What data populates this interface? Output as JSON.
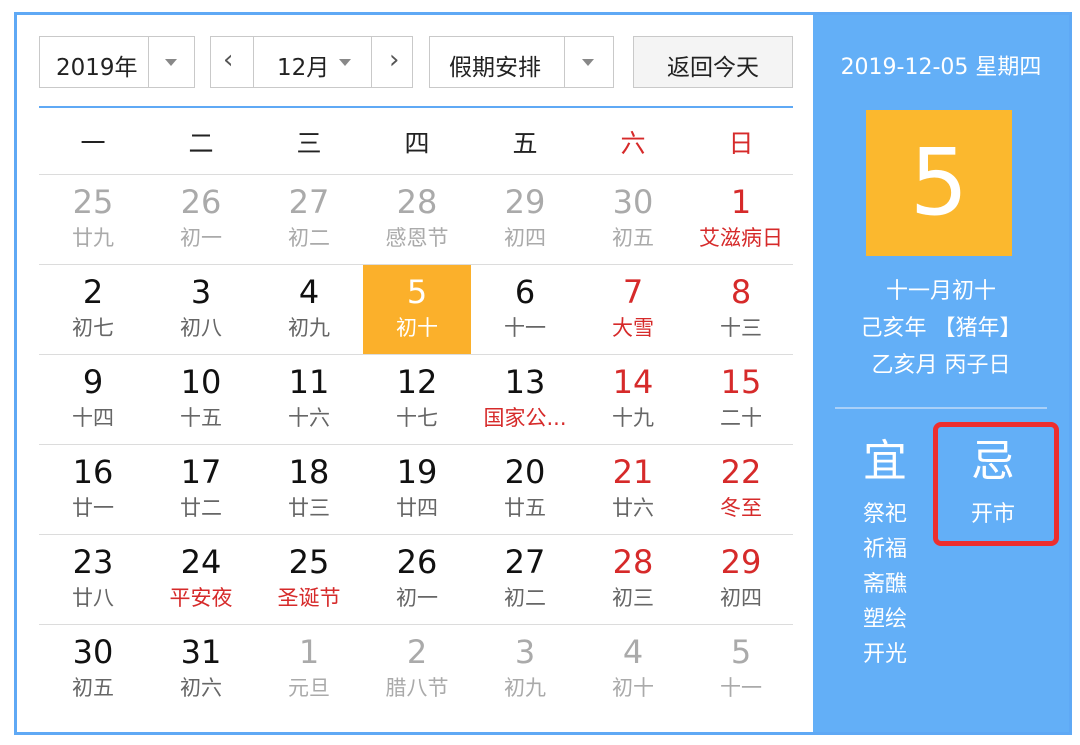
{
  "toolbar": {
    "year": "2019年",
    "month": "12月",
    "prev_icon": "‹",
    "next_icon": "›",
    "holiday": "假期安排",
    "today": "返回今天"
  },
  "weekdays": [
    "一",
    "二",
    "三",
    "四",
    "五",
    "六",
    "日"
  ],
  "weeks": [
    [
      {
        "day": "25",
        "lunar": "廿九",
        "other": true
      },
      {
        "day": "26",
        "lunar": "初一",
        "other": true
      },
      {
        "day": "27",
        "lunar": "初二",
        "other": true
      },
      {
        "day": "28",
        "lunar": "感恩节",
        "other": true
      },
      {
        "day": "29",
        "lunar": "初四",
        "other": true
      },
      {
        "day": "30",
        "lunar": "初五",
        "other": true
      },
      {
        "day": "1",
        "lunar": "艾滋病日",
        "red": true
      }
    ],
    [
      {
        "day": "2",
        "lunar": "初七"
      },
      {
        "day": "3",
        "lunar": "初八"
      },
      {
        "day": "4",
        "lunar": "初九"
      },
      {
        "day": "5",
        "lunar": "初十",
        "selected": true
      },
      {
        "day": "6",
        "lunar": "十一"
      },
      {
        "day": "7",
        "lunar": "大雪",
        "red": true
      },
      {
        "day": "8",
        "lunar": "十三"
      }
    ],
    [
      {
        "day": "9",
        "lunar": "十四"
      },
      {
        "day": "10",
        "lunar": "十五"
      },
      {
        "day": "11",
        "lunar": "十六"
      },
      {
        "day": "12",
        "lunar": "十七"
      },
      {
        "day": "13",
        "lunar": "国家公...",
        "red": true
      },
      {
        "day": "14",
        "lunar": "十九"
      },
      {
        "day": "15",
        "lunar": "二十"
      }
    ],
    [
      {
        "day": "16",
        "lunar": "廿一"
      },
      {
        "day": "17",
        "lunar": "廿二"
      },
      {
        "day": "18",
        "lunar": "廿三"
      },
      {
        "day": "19",
        "lunar": "廿四"
      },
      {
        "day": "20",
        "lunar": "廿五"
      },
      {
        "day": "21",
        "lunar": "廿六"
      },
      {
        "day": "22",
        "lunar": "冬至",
        "red": true
      }
    ],
    [
      {
        "day": "23",
        "lunar": "廿八"
      },
      {
        "day": "24",
        "lunar": "平安夜",
        "red": true
      },
      {
        "day": "25",
        "lunar": "圣诞节",
        "red": true
      },
      {
        "day": "26",
        "lunar": "初一"
      },
      {
        "day": "27",
        "lunar": "初二"
      },
      {
        "day": "28",
        "lunar": "初三"
      },
      {
        "day": "29",
        "lunar": "初四"
      }
    ],
    [
      {
        "day": "30",
        "lunar": "初五"
      },
      {
        "day": "31",
        "lunar": "初六"
      },
      {
        "day": "1",
        "lunar": "元旦",
        "other": true
      },
      {
        "day": "2",
        "lunar": "腊八节",
        "other": true
      },
      {
        "day": "3",
        "lunar": "初九",
        "other": true
      },
      {
        "day": "4",
        "lunar": "初十",
        "other": true
      },
      {
        "day": "5",
        "lunar": "十一",
        "other": true
      }
    ]
  ],
  "panel": {
    "date": "2019-12-05 星期四",
    "big_day": "5",
    "lunar_date": "十一月初十",
    "year_ganzhi": "己亥年 【猪年】",
    "month_day_ganzhi": "乙亥月 丙子日",
    "yi_title": "宜",
    "yi_items": [
      "祭祀",
      "祈福",
      "斋醮",
      "塑绘",
      "开光"
    ],
    "ji_title": "忌",
    "ji_items": [
      "开市"
    ]
  },
  "colors": {
    "accent_blue": "#63aff7",
    "selected_orange": "#fbb02b",
    "weekend_red": "#d62a2a",
    "highlight_box": "#ee2e2e"
  }
}
